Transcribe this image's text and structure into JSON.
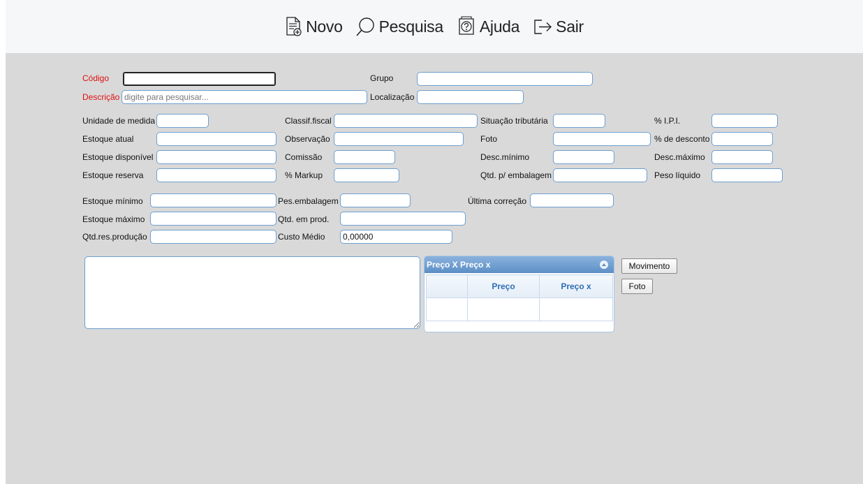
{
  "toolbar": {
    "novo": {
      "label": "Novo",
      "icon": "new-document-icon"
    },
    "pesquisa": {
      "label": "Pesquisa",
      "icon": "search-icon"
    },
    "ajuda": {
      "label": "Ajuda",
      "icon": "help-icon"
    },
    "sair": {
      "label": "Sair",
      "icon": "exit-icon"
    }
  },
  "form": {
    "codigo": {
      "label": "Código",
      "value": ""
    },
    "grupo": {
      "label": "Grupo",
      "value": ""
    },
    "descricao": {
      "label": "Descrição",
      "value": "",
      "placeholder": "digite para pesquisar..."
    },
    "localizacao": {
      "label": "Localização",
      "value": ""
    },
    "unidade_medida": {
      "label": "Unidade de medida",
      "value": ""
    },
    "classif_fiscal": {
      "label": "Classif.fiscal",
      "value": ""
    },
    "situacao_tributaria": {
      "label": "Situação tributária",
      "value": ""
    },
    "ipi": {
      "label": "% I.P.I.",
      "value": ""
    },
    "estoque_atual": {
      "label": "Estoque atual",
      "value": ""
    },
    "observacao": {
      "label": "Observação",
      "value": ""
    },
    "foto": {
      "label": "Foto",
      "value": ""
    },
    "perc_desconto": {
      "label": "% de desconto",
      "value": ""
    },
    "estoque_disponivel": {
      "label": "Estoque disponível",
      "value": ""
    },
    "comissao": {
      "label": "Comissão",
      "value": ""
    },
    "desc_minimo": {
      "label": "Desc.mínimo",
      "value": ""
    },
    "desc_maximo": {
      "label": "Desc.máximo",
      "value": ""
    },
    "estoque_reserva": {
      "label": "Estoque reserva",
      "value": ""
    },
    "markup": {
      "label": "% Markup",
      "value": ""
    },
    "qtd_embalagem": {
      "label": "Qtd. p/ embalagem",
      "value": ""
    },
    "peso_liquido": {
      "label": "Peso líquido",
      "value": ""
    },
    "estoque_minimo": {
      "label": "Estoque mínimo",
      "value": ""
    },
    "pes_embalagem": {
      "label": "Pes.embalagem",
      "value": ""
    },
    "ultima_correcao": {
      "label": "Última correção",
      "value": ""
    },
    "estoque_maximo": {
      "label": "Estoque máximo",
      "value": ""
    },
    "qtd_em_prod": {
      "label": "Qtd. em prod.",
      "value": ""
    },
    "qtd_res_producao": {
      "label": "Qtd.res.produção",
      "value": ""
    },
    "custo_medio": {
      "label": "Custo Médio",
      "value": "0,00000"
    },
    "notes": {
      "value": ""
    }
  },
  "price_grid": {
    "title": "Preço X Preço x",
    "columns": [
      "",
      "Preço",
      "Preço x"
    ],
    "rows": [
      [
        "",
        "",
        ""
      ]
    ]
  },
  "side_buttons": {
    "movimento": "Movimento",
    "foto": "Foto"
  },
  "colors": {
    "required_label": "#e01010",
    "input_border": "#6d9fd0",
    "background": "#d9d9d9",
    "grid_header": "#5c8fc6"
  }
}
